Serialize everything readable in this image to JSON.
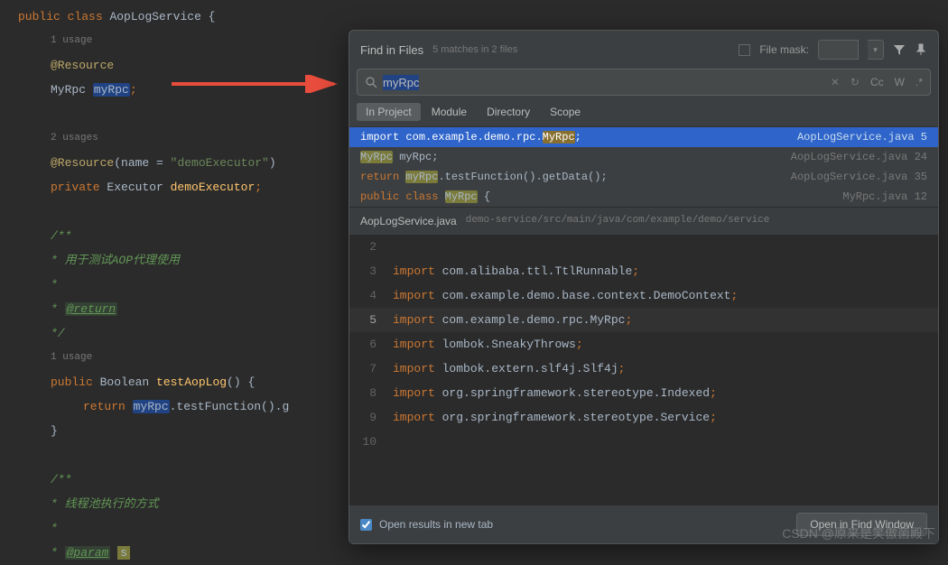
{
  "editor": {
    "line1_kw1": "public",
    "line1_kw2": "class",
    "line1_class": "AopLogService",
    "line1_brace": " {",
    "usage1": "1 usage",
    "annot1": "@Resource",
    "line3_type": "MyRpc ",
    "line3_var": "myRpc",
    "line3_semi": ";",
    "usage2": "2 usages",
    "annot2_pre": "@Resource",
    "annot2_paren": "(",
    "annot2_name": "name = ",
    "annot2_str": "\"demoExecutor\"",
    "annot2_close": ")",
    "line6_kw": "private",
    "line6_type": " Executor ",
    "line6_var": "demoExecutor",
    "line6_semi": ";",
    "doc1_open": "/**",
    "doc1_l1": " * 用于测试AOP代理使用",
    "doc1_l2": " *",
    "doc1_ret_pre": " * ",
    "doc1_ret": "@return",
    "doc1_close": " */",
    "usage3": "1 usage",
    "m_kw": "public",
    "m_type": " Boolean ",
    "m_name": "testAopLog",
    "m_sig": "() {",
    "ret_kw": "return ",
    "ret_var": "myRpc",
    "ret_rest": ".testFunction().g",
    "brace_close": "}",
    "doc2_open": "/**",
    "doc2_l1": " * 线程池执行的方式",
    "doc2_l2": " *",
    "doc2_param_pre": " * ",
    "doc2_param": "@param",
    "doc2_param_s": "s"
  },
  "dialog": {
    "title": "Find in Files",
    "subtitle": "5 matches in 2 files",
    "filemask_label": "File mask:",
    "search_value": "myRpc",
    "search_tools": {
      "cc": "Cc",
      "w": "W",
      "re": ".*"
    },
    "tabs": [
      "In Project",
      "Module",
      "Directory",
      "Scope"
    ],
    "results": [
      {
        "pre_kw": "import",
        "mid": " com.example.demo.rpc.",
        "match": "MyRpc",
        "post": ";",
        "file": "AopLogService.java",
        "line": "5",
        "selected": true
      },
      {
        "match": "MyRpc",
        "mid": " ",
        "post_id": "myRpc",
        "semi": ";",
        "file": "AopLogService.java",
        "line": "24"
      },
      {
        "pre_kw": "return",
        "mid": " ",
        "match": "myRpc",
        "post": ".testFunction().getData();",
        "file": "AopLogService.java",
        "line": "35"
      },
      {
        "pre_kw": "public class",
        "mid": " ",
        "match": "MyRpc",
        "post": " {",
        "file": "MyRpc.java",
        "line": "12"
      }
    ],
    "preview": {
      "filename": "AopLogService.java",
      "path": "demo-service/src/main/java/com/example/demo/service",
      "lines": [
        {
          "n": "2",
          "kw": "",
          "rest": ""
        },
        {
          "n": "3",
          "kw": "import",
          "pkg": " com.alibaba.ttl.",
          "cls": "TtlRunnable",
          "semi": ";"
        },
        {
          "n": "4",
          "kw": "import",
          "pkg": " com.example.demo.base.context.",
          "cls": "DemoContext",
          "semi": ";"
        },
        {
          "n": "5",
          "kw": "import",
          "pkg": " com.example.demo.rpc.",
          "cls": "MyRpc",
          "semi": ";",
          "current": true
        },
        {
          "n": "6",
          "kw": "import",
          "pkg": " lombok.",
          "cls": "SneakyThrows",
          "semi": ";"
        },
        {
          "n": "7",
          "kw": "import",
          "pkg": " lombok.extern.slf4j.",
          "cls": "Slf4j",
          "semi": ";"
        },
        {
          "n": "8",
          "kw": "import",
          "pkg": " org.springframework.stereotype.",
          "cls": "Indexed",
          "semi": ";"
        },
        {
          "n": "9",
          "kw": "import",
          "pkg": " org.springframework.stereotype.",
          "cls": "Service",
          "semi": ";"
        },
        {
          "n": "10",
          "kw": "",
          "rest": ""
        }
      ]
    },
    "footer": {
      "checkbox_label": "Open results in new tab",
      "button": "Open in Find Window"
    }
  },
  "watermark": "CSDN @原来是笑傲菌殿下"
}
